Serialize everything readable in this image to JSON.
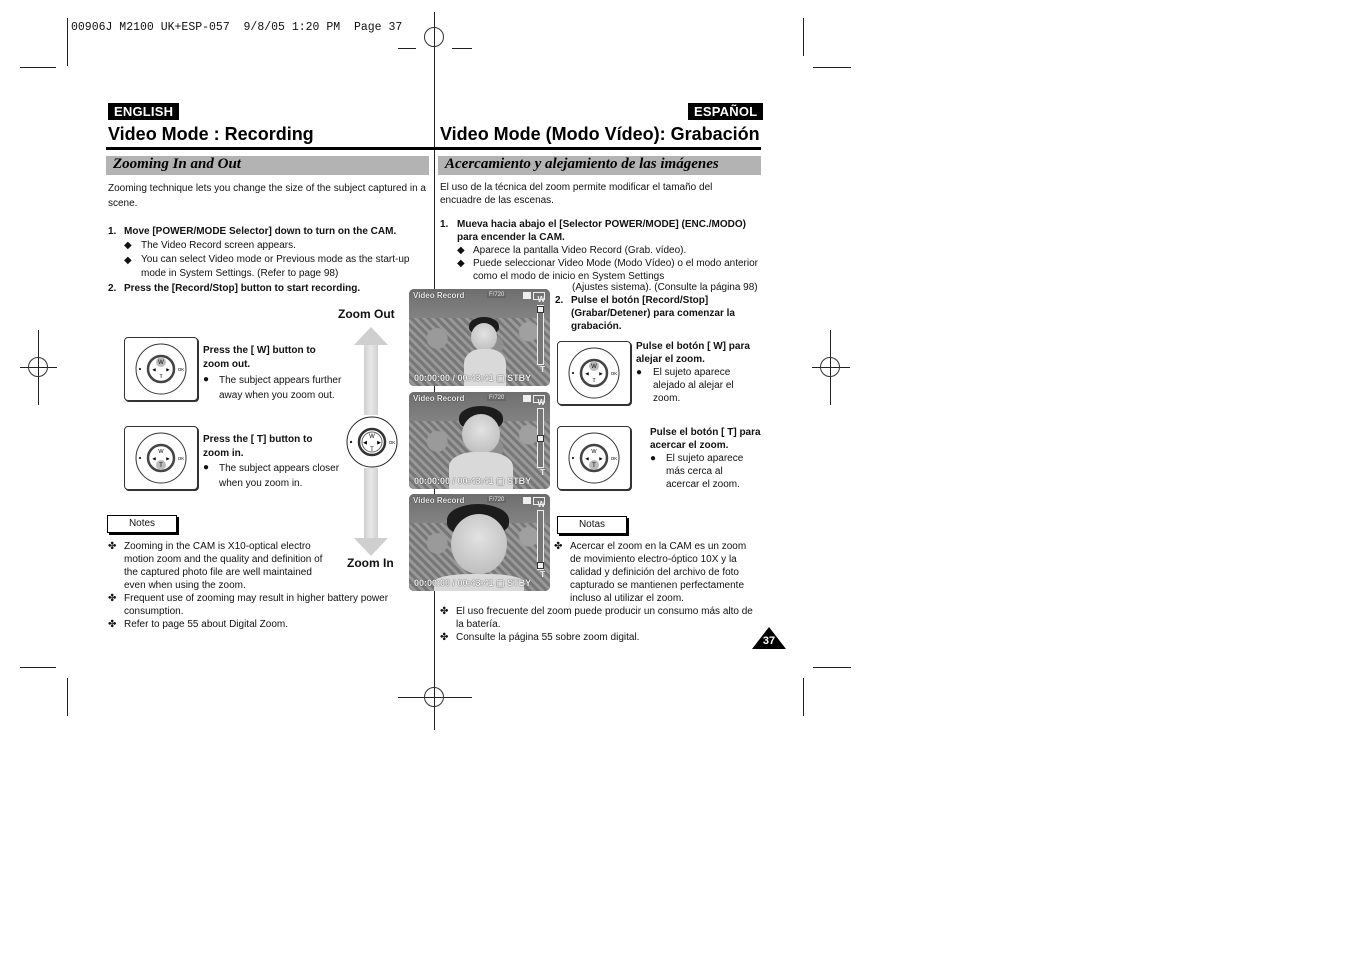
{
  "slug": "00906J M2100 UK+ESP-057  9/8/05 1:20 PM  Page 37",
  "page_number": "37",
  "english": {
    "lang_label": "ENGLISH",
    "title": "Video Mode : Recording",
    "section": "Zooming In and Out",
    "intro": "Zooming technique lets you change the size of the subject captured in a scene.",
    "steps": [
      {
        "num": "1.",
        "text": "Move [POWER/MODE Selector] down to turn on the CAM.",
        "bullets": [
          "The Video Record screen appears.",
          "You can select Video mode or Previous mode as the start-up mode in System Settings. (Refer to page 98)"
        ]
      },
      {
        "num": "2.",
        "text": "Press the [Record/Stop] button to start recording."
      }
    ],
    "zoom_out_label": "Zoom Out",
    "zoom_in_label": "Zoom In",
    "zoom_out": {
      "title": "Press the [ W] button to zoom out.",
      "bullet": "The subject appears further away when you zoom out."
    },
    "zoom_in": {
      "title": "Press the [ T] button to zoom in.",
      "bullet": "The subject appears closer   when you zoom in."
    },
    "notes_label": "Notes",
    "notes": [
      "Zooming in the CAM is X10-optical electro motion zoom and the quality and definition of the captured photo file are well maintained even when using the zoom.",
      "Frequent use of zooming may result in higher battery power consumption.",
      "Refer to page 55 about Digital Zoom."
    ]
  },
  "spanish": {
    "lang_label": "ESPAÑOL",
    "title": "Video Mode (Modo Vídeo): Grabación",
    "section": "Acercamiento y alejamiento de las imágenes",
    "intro": "El uso de la técnica del zoom permite modificar el tamaño del encuadre de las escenas.",
    "steps": [
      {
        "num": "1.",
        "text": "Mueva hacia abajo el [Selector POWER/MODE] (ENC./MODO) para encender la CAM.",
        "bullets": [
          "Aparece la pantalla Video Record (Grab. vídeo).",
          "Puede seleccionar Video Mode (Modo Vídeo) o el modo anterior como el modo de inicio en System Settings",
          "(Ajustes sistema). (Consulte la página 98)"
        ]
      },
      {
        "num": "2.",
        "text": "Pulse el botón [Record/Stop] (Grabar/Detener) para comenzar la grabación."
      }
    ],
    "zoom_out": {
      "title": "Pulse el botón [ W] para alejar el zoom.",
      "bullet": "El sujeto aparece alejado al alejar el zoom."
    },
    "zoom_in": {
      "title": "Pulse el botón [ T] para acercar el zoom.",
      "bullet": "El sujeto aparece más cerca al acercar el zoom."
    },
    "notes_label": "Notas",
    "notes": [
      "Acercar el zoom en la CAM es un zoom de movimiento electro-óptico 10X y la calidad y definición del archivo de foto capturado se mantienen perfectamente incluso al utilizar el zoom.",
      "El uso frecuente del zoom puede producir un consumo más alto de la batería.",
      "Consulte la página 55 sobre zoom digital."
    ]
  },
  "screens": [
    {
      "mode": "Video Record",
      "resolution": "F/720",
      "time": "00:00:00 / 00:43:41",
      "status": "STBY",
      "zoom_w": "W",
      "zoom_t": "T",
      "zoom_level": 0.0
    },
    {
      "mode": "Video Record",
      "resolution": "F/720",
      "time": "00:00:00 / 00:43:41",
      "status": "STBY",
      "zoom_w": "W",
      "zoom_t": "T",
      "zoom_level": 0.5
    },
    {
      "mode": "Video Record",
      "resolution": "F/720",
      "time": "00:00:00 / 00:43:41",
      "status": "STBY",
      "zoom_w": "W",
      "zoom_t": "T",
      "zoom_level": 1.0
    }
  ],
  "control": {
    "w": "W",
    "t": "T",
    "ok": "OK"
  },
  "symbols": {
    "diamond": "◆",
    "dot": "●",
    "cross": "✤"
  }
}
